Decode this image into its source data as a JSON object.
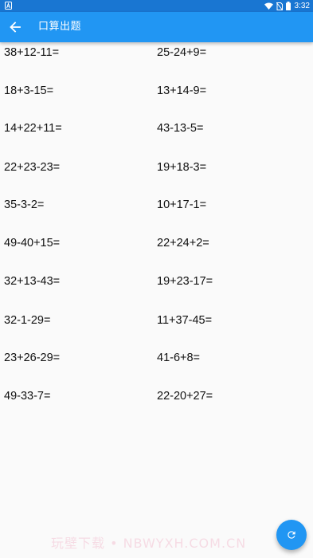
{
  "status_bar": {
    "time": "3:32",
    "left_icon": "notification-a-icon",
    "icons": [
      "wifi-icon",
      "no-sim-icon",
      "battery-icon"
    ]
  },
  "app_bar": {
    "back_icon": "arrow-left-icon",
    "title": "口算出题"
  },
  "problems": [
    [
      "38+12-11=",
      "25-24+9="
    ],
    [
      "18+3-15=",
      "13+14-9="
    ],
    [
      "14+22+11=",
      "43-13-5="
    ],
    [
      "22+23-23=",
      "19+18-3="
    ],
    [
      "35-3-2=",
      "10+17-1="
    ],
    [
      "49-40+15=",
      "22+24+2="
    ],
    [
      "32+13-43=",
      "19+23-17="
    ],
    [
      "32-1-29=",
      "11+37-45="
    ],
    [
      "23+26-29=",
      "41-6+8="
    ],
    [
      "49-33-7=",
      "22-20+27="
    ]
  ],
  "fab": {
    "icon": "refresh-icon"
  },
  "watermark": "玩壁下载 • NBWYXH.COM.CN",
  "colors": {
    "primary": "#2196f3",
    "status_bar": "#1976d2",
    "background": "#fafafa",
    "text": "#111111"
  }
}
